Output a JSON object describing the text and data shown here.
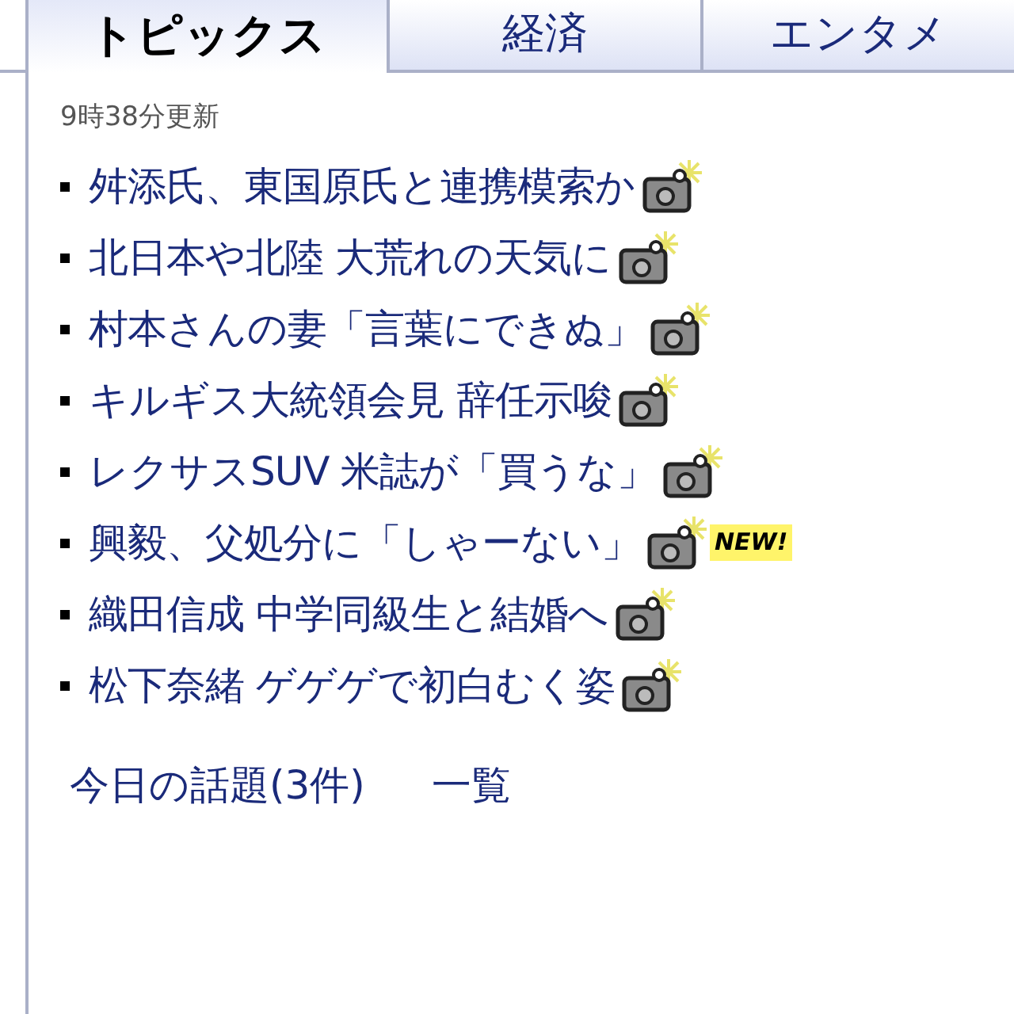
{
  "tabs": [
    {
      "label": "トピックス",
      "selected": true
    },
    {
      "label": "経済",
      "selected": false
    },
    {
      "label": "エンタメ",
      "selected": false
    }
  ],
  "updated": "9時38分更新",
  "headlines": [
    {
      "title": "舛添氏、東国原氏と連携模索か",
      "photo": true,
      "new": false
    },
    {
      "title": "北日本や北陸 大荒れの天気に",
      "photo": true,
      "new": false
    },
    {
      "title": "村本さんの妻「言葉にできぬ」",
      "photo": true,
      "new": false
    },
    {
      "title": "キルギス大統領会見 辞任示唆",
      "photo": true,
      "new": false
    },
    {
      "title": "レクサスSUV 米誌が「買うな」",
      "photo": true,
      "new": false
    },
    {
      "title": "興毅、父処分に「しゃーない」",
      "photo": true,
      "new": true,
      "new_label": "NEW!"
    },
    {
      "title": "織田信成 中学同級生と結婚へ",
      "photo": true,
      "new": false
    },
    {
      "title": "松下奈緒 ゲゲゲで初白むく姿",
      "photo": true,
      "new": false
    }
  ],
  "footer_links": [
    "今日の話題(3件)",
    "一覧"
  ]
}
